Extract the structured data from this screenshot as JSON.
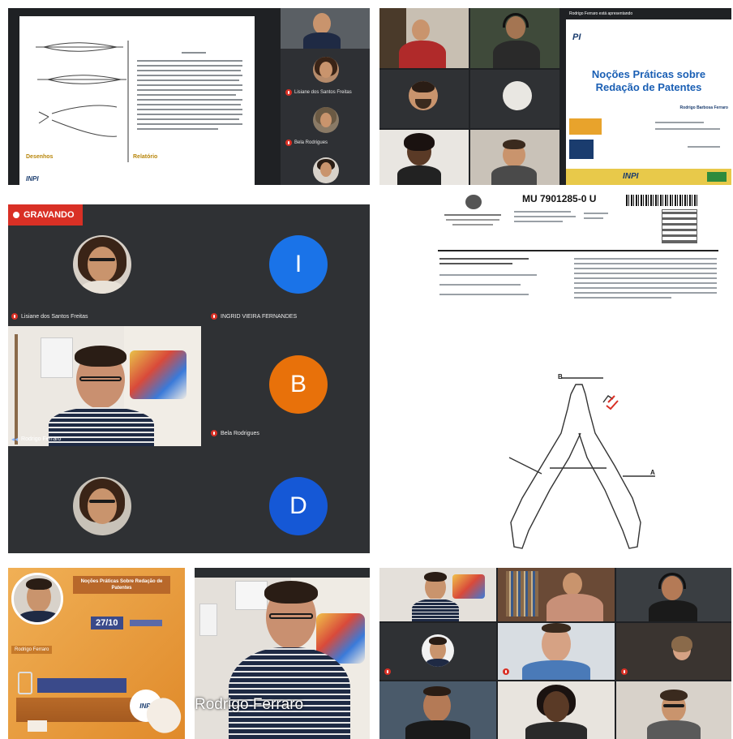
{
  "panel1": {
    "doc_heading_left": "Desenhos",
    "doc_heading_right": "Relatório",
    "doc_logo": "INPI",
    "participants": [
      {
        "name": "Lisiane dos Santos Freitas"
      },
      {
        "name": "Bela Rodrigues"
      },
      {
        "name": ""
      }
    ]
  },
  "panel2": {
    "top_bar": "Rodrigo Ferraro está apresentando",
    "slide_logo": "PI",
    "slide_title": "Noções Práticas sobre Redação de Patentes",
    "slide_presenter": "Rodrigo Barbosa Ferraro",
    "footer_logo": "INPI"
  },
  "panel3": {
    "recording_label": "GRAVANDO",
    "tiles": [
      {
        "name": "Lisiane dos Santos Freitas",
        "kind": "photo"
      },
      {
        "name": "INGRID VIEIRA FERNANDES",
        "kind": "letter",
        "letter": "I",
        "color": "#1a73e8"
      },
      {
        "name": "Rodrigo Ferraro",
        "kind": "video"
      },
      {
        "name": "Bela Rodrigues",
        "kind": "letter",
        "letter": "B",
        "color": "#e8710a"
      },
      {
        "name": "",
        "kind": "photo"
      },
      {
        "name": "",
        "kind": "letter",
        "letter": "D",
        "color": "#1558d6"
      }
    ]
  },
  "panel4": {
    "patent_number": "MU 7901285-0 U",
    "labels": [
      "B",
      "A"
    ]
  },
  "panel5": {
    "title": "Noções Práticas Sobre Redação de Patentes",
    "date": "27/10",
    "presenter": "Rodrigo Ferraro",
    "logo": "INPI"
  },
  "panel6": {
    "name": "Rodrigo Ferraro"
  },
  "colors": {
    "recording": "#d93025",
    "meet_bg": "#2f3134",
    "slide_title": "#1a5fb4",
    "flyer": "#e89a3a"
  }
}
